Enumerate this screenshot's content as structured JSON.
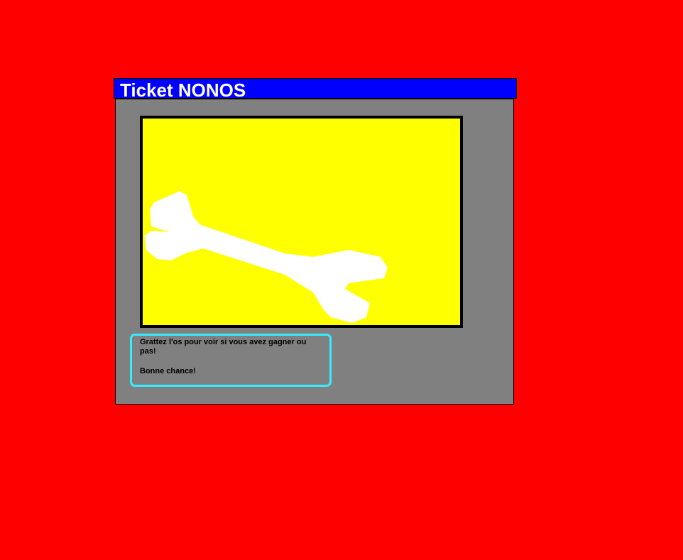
{
  "window": {
    "title": "Ticket NONOS"
  },
  "scratch_card": {
    "image_icon": "bone-icon",
    "colors": {
      "card": "#ffff00",
      "bone": "#ffffff",
      "frame": "#000000"
    }
  },
  "message": {
    "instruction": "Grattez l'os pour voir si vous avez gagner ou pas!",
    "wish": "Bonne chance!"
  },
  "colors": {
    "background": "#ff0000",
    "title_bar": "#0000ff",
    "panel": "#808080",
    "message_border": "#33eeff"
  }
}
